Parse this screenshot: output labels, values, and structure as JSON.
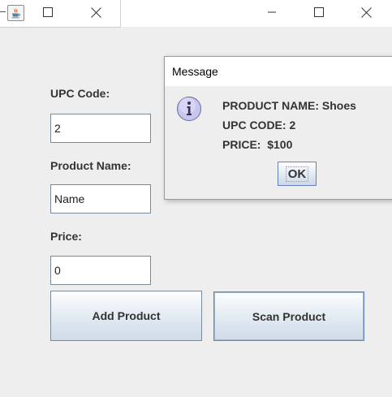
{
  "background_window": {
    "icon": "java-cup-icon",
    "controls": [
      "minimize-icon",
      "maximize-icon",
      "close-icon"
    ]
  },
  "main_window": {
    "controls": [
      "minimize-icon",
      "maximize-icon",
      "close-icon"
    ],
    "form": {
      "upc_label": "UPC Code:",
      "upc_value": "2",
      "name_label": "Product Name:",
      "name_value": "Name",
      "price_label": "Price:",
      "price_value": "0"
    },
    "buttons": {
      "add": "Add Product",
      "scan": "Scan Product"
    }
  },
  "dialog": {
    "title": "Message",
    "icon": "information-icon",
    "lines": [
      "PRODUCT NAME: Shoes",
      "UPC CODE: 2",
      "PRICE:  $100"
    ],
    "ok_label": "OK"
  },
  "colors": {
    "window_bg": "#eeeeee",
    "titlebar_bg": "#ffffff",
    "text": "#333333",
    "button_border": "#7a8a99",
    "focus_border": "#6382bf",
    "info_icon_fill": "#c9c6ee"
  }
}
